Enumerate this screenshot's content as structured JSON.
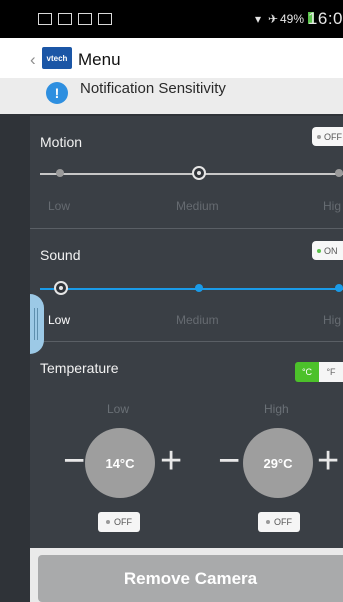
{
  "status_bar": {
    "battery_percent": "49%",
    "time": "16:0",
    "icons": [
      "image-icon",
      "mail-icon",
      "bag-icon",
      "bag-icon",
      "wifi-icon",
      "airplane-icon",
      "battery-icon"
    ]
  },
  "header": {
    "back_icon": "chevron-left-icon",
    "logo_text": "vtech",
    "title": "Menu"
  },
  "notification": {
    "icon": "warning-icon",
    "label": "Notification Sensitivity"
  },
  "motion": {
    "title": "Motion",
    "toggle": "OFF",
    "level": "Medium",
    "labels": [
      "Low",
      "Medium",
      "Hig"
    ]
  },
  "sound": {
    "title": "Sound",
    "toggle": "ON",
    "level": "Low",
    "labels": [
      "Low",
      "Medium",
      "Hig"
    ]
  },
  "temperature": {
    "title": "Temperature",
    "units": [
      "°C",
      "°F"
    ],
    "selected_unit": "°C",
    "low": {
      "caption": "Low",
      "value": "14°C",
      "status": "OFF"
    },
    "high": {
      "caption": "High",
      "value": "29°C",
      "status": "OFF"
    }
  },
  "remove_button": "Remove Camera",
  "colors": {
    "accent": "#1a9be8",
    "toggle_on_dot": "#5bc24c",
    "unit_selected": "#4cc12a",
    "panel": "#3a3f45"
  }
}
